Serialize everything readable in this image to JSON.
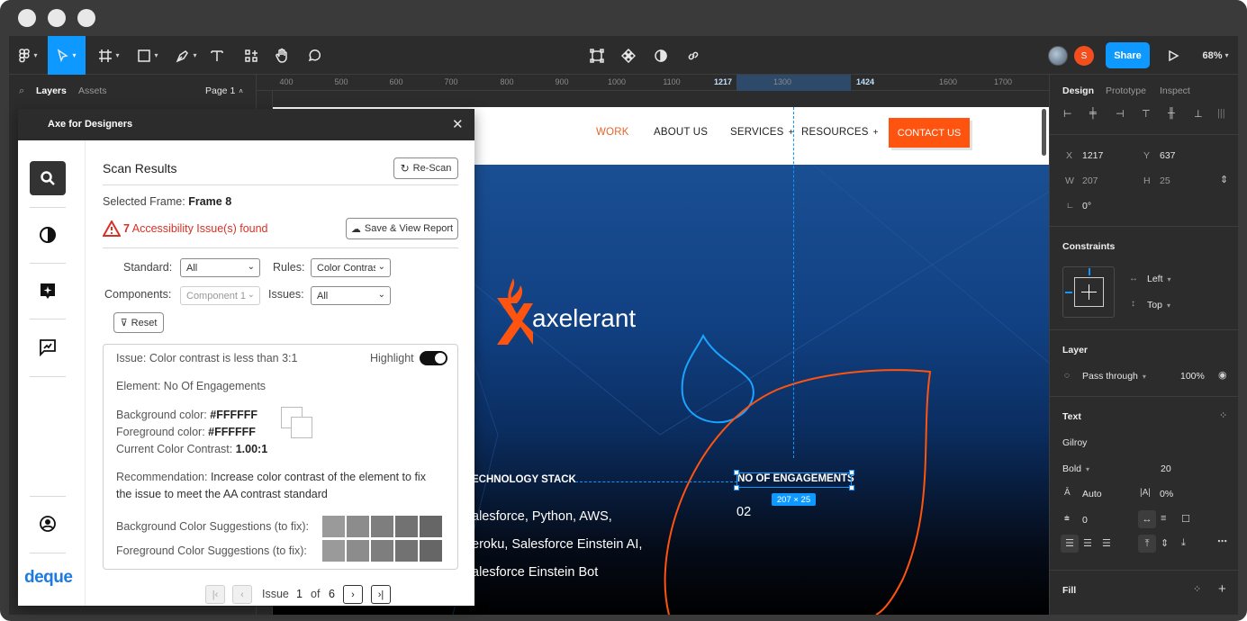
{
  "toolbar": {
    "share_label": "Share",
    "zoom": "68%",
    "avatar_letter": "S"
  },
  "layers_panel": {
    "tab_layers": "Layers",
    "tab_assets": "Assets",
    "page": "Page 1"
  },
  "ruler": {
    "ticks": [
      "400",
      "500",
      "600",
      "700",
      "800",
      "900",
      "1000",
      "1100",
      "1217",
      "1300",
      "1424",
      "1600",
      "1700"
    ]
  },
  "site": {
    "nav": [
      "WORK",
      "ABOUT US",
      "SERVICES",
      "RESOURCES"
    ],
    "contact": "CONTACT US",
    "logo_text": "axelerant",
    "tech_stack": "ECHNOLOGY STACK",
    "engagements": "NO OF ENGAGEMENTS",
    "engagements_value": "02",
    "stack_line1": "alesforce, Python, AWS,",
    "stack_line2": "eroku, Salesforce Einstein AI,",
    "stack_line3": "alesforce Einstein Bot",
    "dim_label": "207 × 25"
  },
  "plugin": {
    "title": "Axe for Designers",
    "heading": "Scan Results",
    "rescan": "Re-Scan",
    "selected_frame_label": "Selected Frame:",
    "selected_frame_value": "Frame 8",
    "issue_count": "7",
    "issue_found": "Accessibility Issue(s) found",
    "save_report": "Save & View Report",
    "standard_label": "Standard:",
    "standard_value": "All",
    "rules_label": "Rules:",
    "rules_value": "Color Contrast",
    "components_label": "Components:",
    "components_value": "Component 1",
    "issues_label": "Issues:",
    "issues_value": "All",
    "reset": "Reset",
    "issue_text": "Issue: Color contrast is less than 3:1",
    "highlight": "Highlight",
    "element_text": "Element: No Of Engagements",
    "bg_color_label": "Background color:",
    "bg_color_value": "#FFFFFF",
    "fg_color_label": "Foreground color:",
    "fg_color_value": "#FFFFFF",
    "contrast_label": "Current Color Contrast:",
    "contrast_value": "1.00:1",
    "recommendation_label": "Recommendation:",
    "recommendation_line1": "Increase color contrast of the element to fix",
    "recommendation_line2": "the issue to meet the AA contrast standard",
    "bg_suggestions": "Background Color Suggestions (to fix):",
    "fg_suggestions": "Foreground Color Suggestions (to fix):",
    "pager_issue": "Issue",
    "pager_current": "1",
    "pager_of": "of",
    "pager_total": "6",
    "brand": "deque"
  },
  "design_panel": {
    "tab_design": "Design",
    "tab_prototype": "Prototype",
    "tab_inspect": "Inspect",
    "x_label": "X",
    "x_value": "1217",
    "y_label": "Y",
    "y_value": "637",
    "w_label": "W",
    "w_value": "207",
    "h_label": "H",
    "h_value": "25",
    "rotation": "0°",
    "constraints": "Constraints",
    "constraint_h": "Left",
    "constraint_v": "Top",
    "layer": "Layer",
    "blend": "Pass through",
    "opacity": "100%",
    "text": "Text",
    "font": "Gilroy",
    "weight": "Bold",
    "size": "20",
    "line_height": "Auto",
    "letter_spacing": "0%",
    "paragraph": "0",
    "fill": "Fill"
  },
  "colors": {
    "figma_blue": "#0d99ff",
    "axe_red": "#d93025",
    "brand_orange": "#ff5310",
    "swatch_gray": "#8a8a8a"
  }
}
